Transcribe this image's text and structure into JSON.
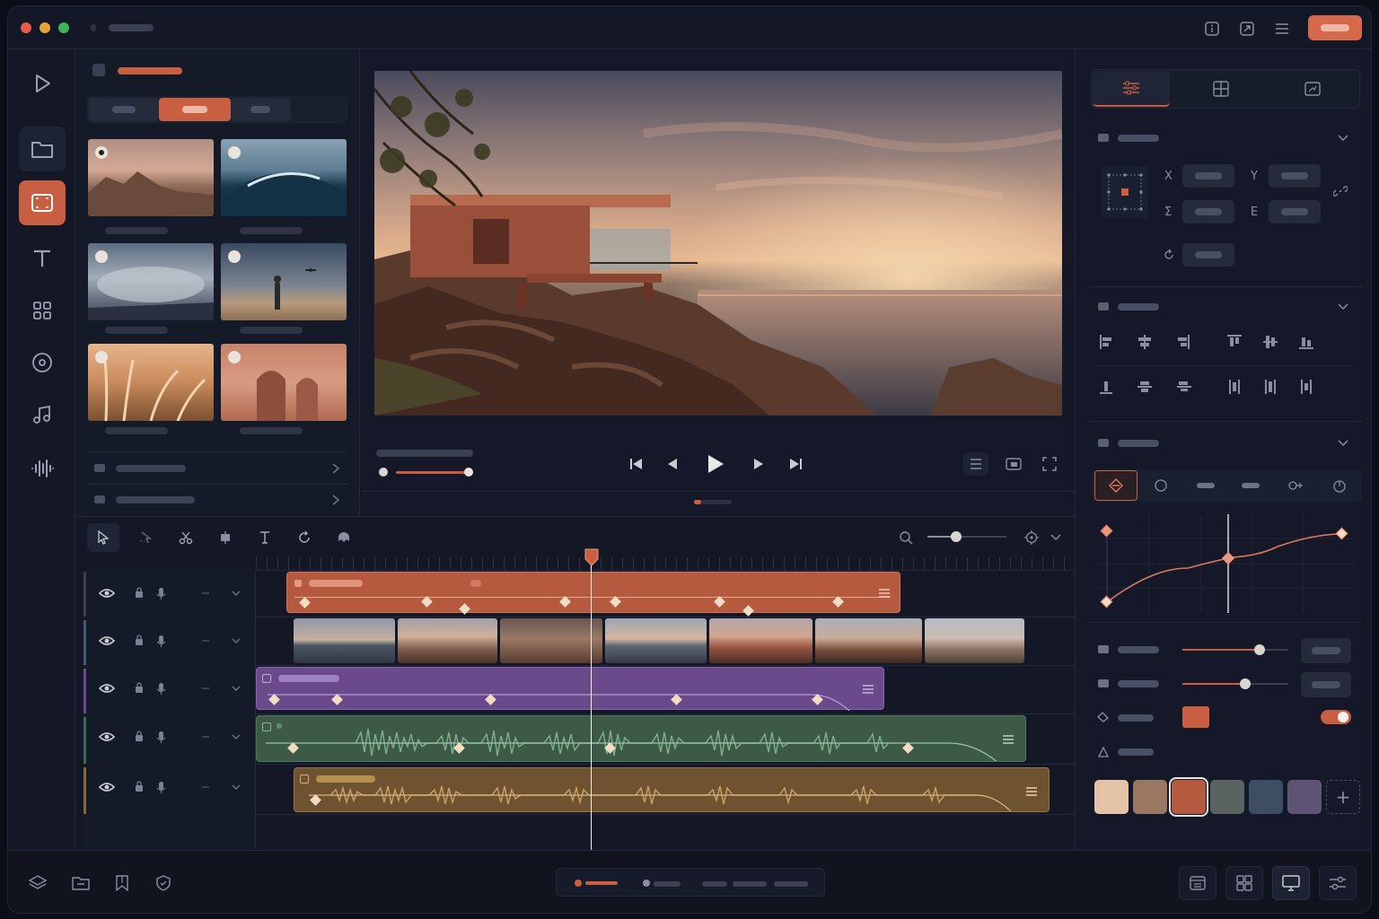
{
  "window": {
    "traffic_lights": [
      "#e35b4f",
      "#e5a33a",
      "#3fb35a"
    ]
  },
  "toolbar_icons": [
    "info-icon",
    "export-icon",
    "menu-icon"
  ],
  "left_rail": [
    {
      "name": "play-icon",
      "active": false
    },
    {
      "name": "folder-icon",
      "active": false
    },
    {
      "name": "media-frame-icon",
      "active": true
    },
    {
      "name": "text-icon",
      "active": false
    },
    {
      "name": "grid-icon",
      "active": false
    },
    {
      "name": "disc-icon",
      "active": false
    },
    {
      "name": "music-icon",
      "active": false
    },
    {
      "name": "waveform-icon",
      "active": false
    }
  ],
  "colors": {
    "accent": "#c85f43",
    "track_video_a": "#b5593f",
    "track_purple": "#6a4a8a",
    "track_green": "#3c5a46",
    "track_gold": "#6f5330"
  },
  "media_thumbs": [
    {
      "name": "coastal-rocks",
      "selected": true
    },
    {
      "name": "ocean-wave",
      "selected": false
    },
    {
      "name": "clouds",
      "selected": false
    },
    {
      "name": "drone-figure",
      "selected": false
    },
    {
      "name": "pampas-grass",
      "selected": false
    },
    {
      "name": "arch-corridor",
      "selected": false
    }
  ],
  "inspector": {
    "position_labels": {
      "x": "X",
      "y": "Y",
      "w": "Σ",
      "h": "E"
    }
  },
  "swatches": [
    "#e3c4a6",
    "#9a7760",
    "#b5593f",
    "#596361",
    "#3e4e62",
    "#5e5275"
  ],
  "bottom_icons": [
    "layers-icon",
    "folder-icon",
    "bookmark-icon",
    "shield-icon"
  ],
  "bottom_right_icons": [
    "layout-icon",
    "grid-icon",
    "monitor-icon",
    "sliders-icon"
  ],
  "add_swatch_label": "+"
}
